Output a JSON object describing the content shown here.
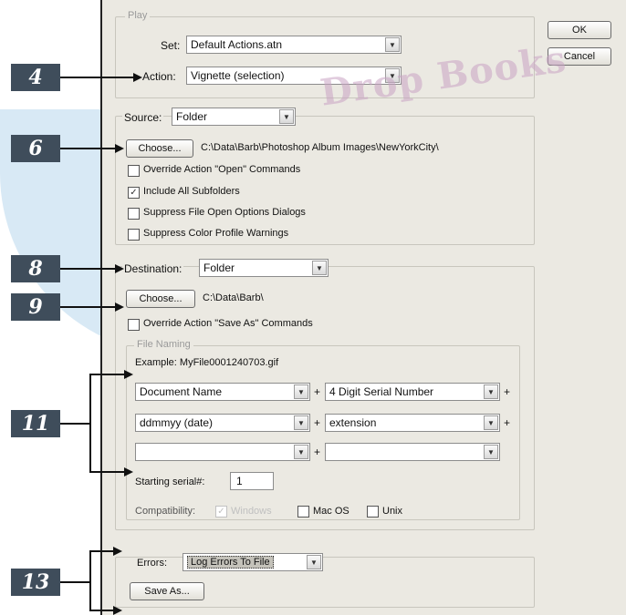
{
  "play": {
    "legend": "Play",
    "set_label": "Set:",
    "set_value": "Default Actions.atn",
    "action_label": "Action:",
    "action_value": "Vignette (selection)"
  },
  "buttons": {
    "ok": "OK",
    "cancel": "Cancel"
  },
  "source": {
    "label": "Source:",
    "value": "Folder",
    "choose": "Choose...",
    "path": "C:\\Data\\Barb\\Photoshop Album Images\\NewYorkCity\\",
    "checkboxes": [
      {
        "label": "Override Action \"Open\" Commands",
        "checked": false
      },
      {
        "label": "Include All Subfolders",
        "checked": true
      },
      {
        "label": "Suppress File Open Options Dialogs",
        "checked": false
      },
      {
        "label": "Suppress Color Profile Warnings",
        "checked": false
      }
    ]
  },
  "destination": {
    "label": "Destination:",
    "value": "Folder",
    "choose": "Choose...",
    "path": "C:\\Data\\Barb\\",
    "override": {
      "label": "Override Action \"Save As\" Commands",
      "checked": false
    }
  },
  "file_naming": {
    "legend": "File Naming",
    "example": "Example: MyFile0001240703.gif",
    "rows": [
      {
        "left": "Document Name",
        "right": "4 Digit Serial Number"
      },
      {
        "left": "ddmmyy (date)",
        "right": "extension"
      },
      {
        "left": "",
        "right": ""
      }
    ],
    "plus": "+",
    "serial_label": "Starting serial#:",
    "serial_value": "1",
    "compat_label": "Compatibility:",
    "compat": [
      {
        "label": "Windows",
        "checked": true,
        "disabled": true
      },
      {
        "label": "Mac OS",
        "checked": false
      },
      {
        "label": "Unix",
        "checked": false
      }
    ]
  },
  "errors": {
    "label": "Errors:",
    "value": "Log Errors To File",
    "save_as": "Save As..."
  },
  "callouts": [
    "4",
    "6",
    "8",
    "9",
    "11",
    "13"
  ],
  "watermark": "Drop Books",
  "colors": {
    "callout_bg": "#3f4d5b",
    "dialog_bg": "#ebe9e2",
    "watermark_bg": "#d8e9f5"
  }
}
